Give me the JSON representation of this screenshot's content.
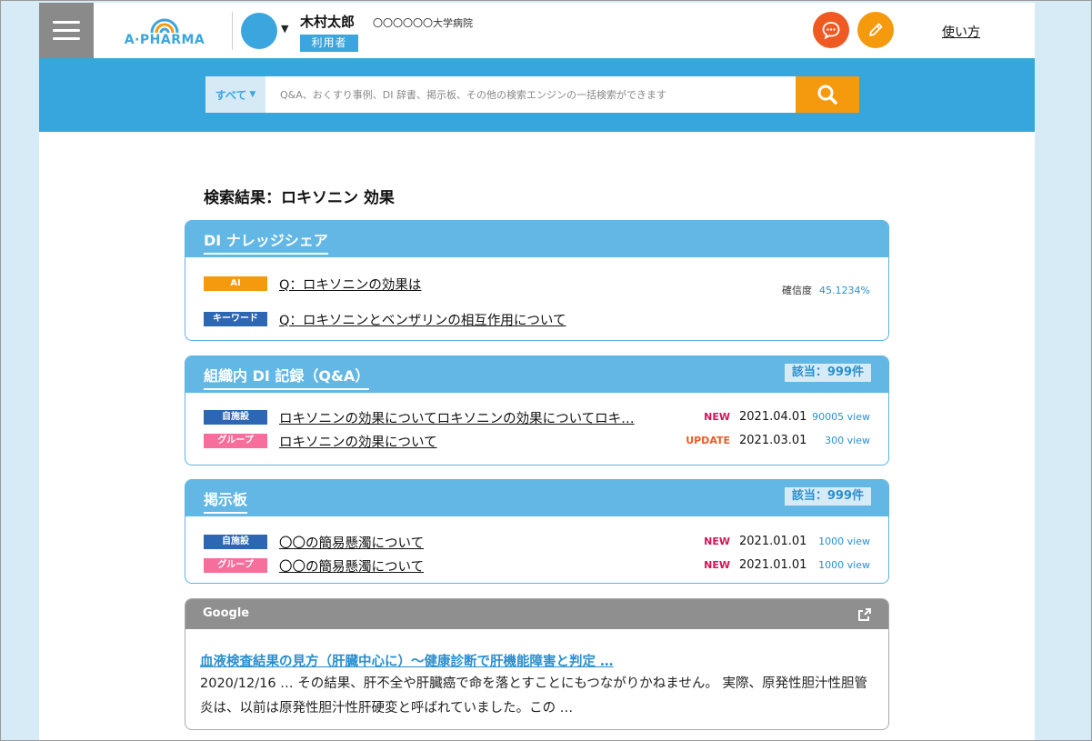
{
  "header": {
    "logo_text": "A·PHARMA",
    "user_name": "木村太郎",
    "hospital": "〇〇〇〇〇〇大学病院",
    "role": "利用者",
    "help_link": "使い方",
    "accent": "#36a6dd"
  },
  "search": {
    "scope_label": "すべて",
    "placeholder": "Q&A、おくすり事例、DI 辞書、掲示板、その他の検索エンジンの一括検索ができます"
  },
  "results_title": "検索結果：ロキソニン 効果",
  "sections": {
    "di_share": {
      "title": "DI ナレッジシェア",
      "items": [
        {
          "tag": "AI",
          "text": "Q：ロキソニンの効果は",
          "conf_label": "確信度",
          "conf_value": "45.1234%"
        },
        {
          "tag": "キーワード",
          "text": "Q：ロキソニンとベンザリンの相互作用について"
        }
      ]
    },
    "org_di": {
      "title": "組織内 DI 記録（Q&A）",
      "count": "該当：999件",
      "items": [
        {
          "tag": "自施設",
          "text": "ロキソニンの効果についてロキソニンの効果についてロキ…",
          "badge": "NEW",
          "date": "2021.04.01",
          "views": "90005 view"
        },
        {
          "tag": "グループ",
          "text": "ロキソニンの効果について",
          "badge": "UPDATE",
          "date": "2021.03.01",
          "views": "300 view"
        }
      ]
    },
    "board": {
      "title": "掲示板",
      "count": "該当：999件",
      "items": [
        {
          "tag": "自施設",
          "text": "〇〇の簡易懸濁について",
          "badge": "NEW",
          "date": "2021.01.01",
          "views": "1000 view"
        },
        {
          "tag": "グループ",
          "text": "〇〇の簡易懸濁について",
          "badge": "NEW",
          "date": "2021.01.01",
          "views": "1000 view"
        }
      ]
    },
    "google": {
      "title": "Google",
      "link": "血液検査結果の見方（肝臓中心に）～健康診断で肝機能障害と判定 …",
      "snippet": "2020/12/16 … その結果、肝不全や肝臓癌で命を落とすことにもつながりかねません。 実際、原発性胆汁性胆管炎は、以前は原発性胆汁性肝硬変と呼ばれていました。この …"
    }
  }
}
